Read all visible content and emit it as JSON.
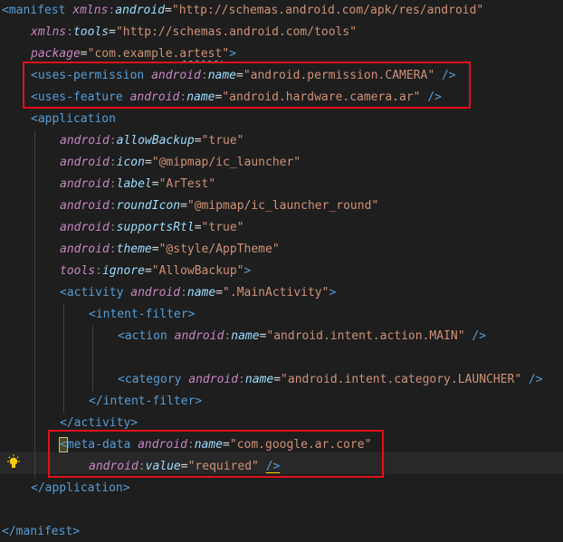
{
  "lines": [
    {
      "parts": [
        [
          "tag",
          "<manifest "
        ],
        [
          "ns",
          "xmlns"
        ],
        [
          "punct",
          ":"
        ],
        [
          "attrns",
          "android"
        ],
        [
          "plain",
          "="
        ],
        [
          "val",
          "\"http://schemas.android.com/apk/res/android\""
        ]
      ]
    },
    {
      "parts": [
        [
          "ns",
          "xmlns"
        ],
        [
          "punct",
          ":"
        ],
        [
          "attrns",
          "tools"
        ],
        [
          "plain",
          "="
        ],
        [
          "val",
          "\"http://schemas.android.com/tools\""
        ]
      ]
    },
    {
      "parts": [
        [
          "ns",
          "package"
        ],
        [
          "plain",
          "="
        ],
        [
          "val",
          "\"com.example."
        ],
        [
          "valsq",
          "artest"
        ],
        [
          "val",
          "\""
        ],
        [
          "tag",
          ">"
        ]
      ]
    },
    {
      "parts": [
        [
          "tag",
          "<uses-permission "
        ],
        [
          "ns",
          "android"
        ],
        [
          "punct",
          ":"
        ],
        [
          "attrns",
          "name"
        ],
        [
          "plain",
          "="
        ],
        [
          "val",
          "\"android.permission.CAMERA\""
        ],
        [
          "tag",
          " />"
        ]
      ]
    },
    {
      "parts": [
        [
          "tag",
          "<uses-feature "
        ],
        [
          "ns",
          "android"
        ],
        [
          "punct",
          ":"
        ],
        [
          "attrns",
          "name"
        ],
        [
          "plain",
          "="
        ],
        [
          "val",
          "\"android.hardware.camera.ar\""
        ],
        [
          "tag",
          " />"
        ]
      ]
    },
    {
      "parts": [
        [
          "tag",
          "<application"
        ]
      ]
    },
    {
      "parts": [
        [
          "ns",
          "android"
        ],
        [
          "punct",
          ":"
        ],
        [
          "attrns",
          "allowBackup"
        ],
        [
          "plain",
          "="
        ],
        [
          "val",
          "\"true\""
        ]
      ]
    },
    {
      "parts": [
        [
          "ns",
          "android"
        ],
        [
          "punct",
          ":"
        ],
        [
          "attrns",
          "icon"
        ],
        [
          "plain",
          "="
        ],
        [
          "val",
          "\"@mipmap/ic_launcher\""
        ]
      ]
    },
    {
      "parts": [
        [
          "ns",
          "android"
        ],
        [
          "punct",
          ":"
        ],
        [
          "attrns",
          "label"
        ],
        [
          "plain",
          "="
        ],
        [
          "val",
          "\"ArTest\""
        ]
      ]
    },
    {
      "parts": [
        [
          "ns",
          "android"
        ],
        [
          "punct",
          ":"
        ],
        [
          "attrns",
          "roundIcon"
        ],
        [
          "plain",
          "="
        ],
        [
          "val",
          "\"@mipmap/ic_launcher_round\""
        ]
      ]
    },
    {
      "parts": [
        [
          "ns",
          "android"
        ],
        [
          "punct",
          ":"
        ],
        [
          "attrns",
          "supportsRtl"
        ],
        [
          "plain",
          "="
        ],
        [
          "val",
          "\"true\""
        ]
      ]
    },
    {
      "parts": [
        [
          "ns",
          "android"
        ],
        [
          "punct",
          ":"
        ],
        [
          "attrns",
          "theme"
        ],
        [
          "plain",
          "="
        ],
        [
          "val",
          "\"@style/AppTheme\""
        ]
      ]
    },
    {
      "parts": [
        [
          "ns",
          "tools"
        ],
        [
          "punct",
          ":"
        ],
        [
          "attrns",
          "ignore"
        ],
        [
          "plain",
          "="
        ],
        [
          "val",
          "\"AllowBackup\""
        ],
        [
          "tag",
          ">"
        ]
      ]
    },
    {
      "parts": [
        [
          "tag",
          "<activity "
        ],
        [
          "ns",
          "android"
        ],
        [
          "punct",
          ":"
        ],
        [
          "attrns",
          "name"
        ],
        [
          "plain",
          "="
        ],
        [
          "val",
          "\".MainActivity\""
        ],
        [
          "tag",
          ">"
        ]
      ]
    },
    {
      "parts": [
        [
          "tag",
          "<intent-filter>"
        ]
      ]
    },
    {
      "parts": [
        [
          "tag",
          "<action "
        ],
        [
          "ns",
          "android"
        ],
        [
          "punct",
          ":"
        ],
        [
          "attrns",
          "name"
        ],
        [
          "plain",
          "="
        ],
        [
          "val",
          "\"android.intent.action.MAIN\""
        ],
        [
          "tag",
          " />"
        ]
      ]
    },
    {
      "parts": []
    },
    {
      "parts": [
        [
          "tag",
          "<category "
        ],
        [
          "ns",
          "android"
        ],
        [
          "punct",
          ":"
        ],
        [
          "attrns",
          "name"
        ],
        [
          "plain",
          "="
        ],
        [
          "val",
          "\"android.intent.category.LAUNCHER\""
        ],
        [
          "tag",
          " />"
        ]
      ]
    },
    {
      "parts": [
        [
          "tag",
          "</intent-filter>"
        ]
      ]
    },
    {
      "parts": [
        [
          "tag",
          "</activity>"
        ]
      ]
    },
    {
      "parts": [
        [
          "tagcur",
          "<"
        ],
        [
          "tag",
          "meta-data "
        ],
        [
          "ns",
          "android"
        ],
        [
          "punct",
          ":"
        ],
        [
          "attrns",
          "name"
        ],
        [
          "plain",
          "="
        ],
        [
          "val",
          "\"com.google.ar.core\""
        ]
      ]
    },
    {
      "parts": [
        [
          "ns",
          "android"
        ],
        [
          "punct",
          ":"
        ],
        [
          "attrns",
          "value"
        ],
        [
          "plain",
          "="
        ],
        [
          "val",
          "\"required\""
        ],
        [
          "plain",
          " "
        ],
        [
          "tagcaret",
          "/>"
        ]
      ]
    },
    {
      "parts": [
        [
          "tag",
          "</application>"
        ]
      ]
    },
    {
      "parts": []
    },
    {
      "parts": [
        [
          "tag",
          "</manifest>"
        ]
      ]
    }
  ]
}
